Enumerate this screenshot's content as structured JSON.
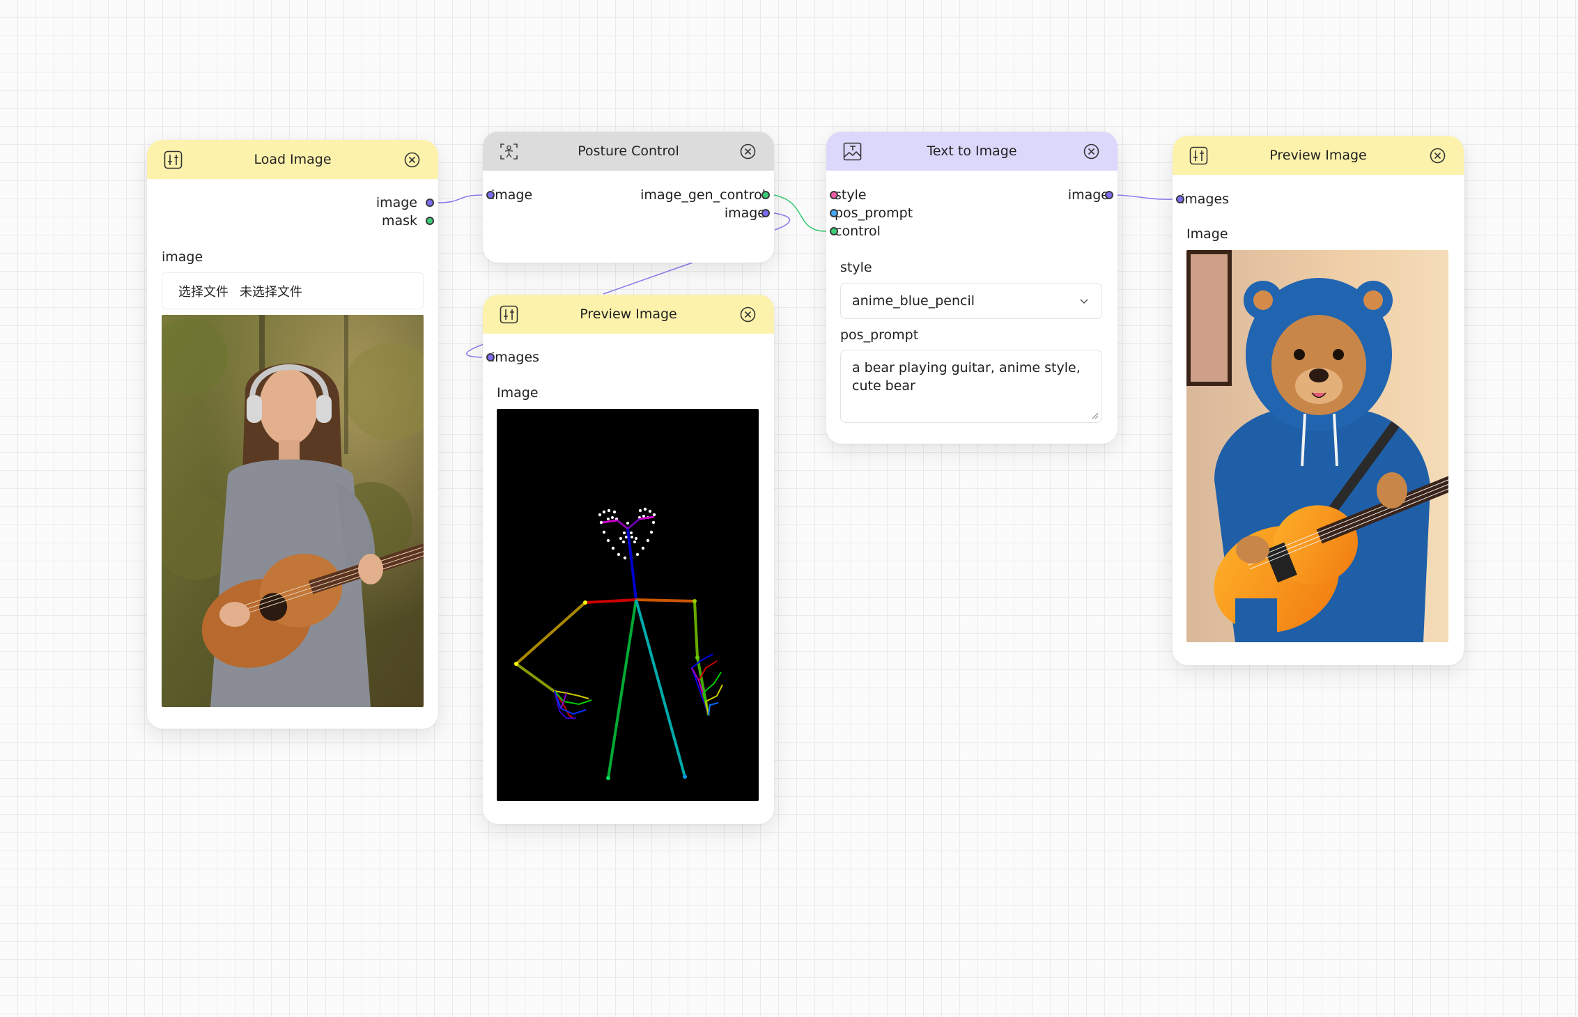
{
  "nodes": {
    "load_image": {
      "title": "Load Image",
      "outputs": [
        "image",
        "mask"
      ],
      "field_label": "image",
      "file_button": "选择文件",
      "file_status": "未选择文件"
    },
    "posture_control": {
      "title": "Posture Control",
      "inputs": [
        "image"
      ],
      "outputs": [
        "image_gen_control",
        "image"
      ]
    },
    "preview_image_pose": {
      "title": "Preview Image",
      "inputs": [
        "images"
      ],
      "field_label": "Image"
    },
    "text_to_image": {
      "title": "Text to Image",
      "inputs": [
        "style",
        "pos_prompt",
        "control"
      ],
      "outputs": [
        "image"
      ],
      "style_label": "style",
      "style_value": "anime_blue_pencil",
      "prompt_label": "pos_prompt",
      "prompt_value": "a bear playing guitar, anime style, cute bear"
    },
    "preview_image_result": {
      "title": "Preview Image",
      "inputs": [
        "images"
      ],
      "field_label": "Image"
    }
  },
  "colors": {
    "header_yellow": "#fcf2ac",
    "header_gray": "#dcdcdc",
    "header_purple": "#dcd8fc",
    "port_image": "#7b6cf2",
    "port_control": "#3dcc78",
    "port_style": "#f05aa8",
    "port_prompt": "#45a8f4",
    "wire_image": "#8a7ef0",
    "wire_control": "#3dcc78"
  },
  "icons": {
    "sliders": "sliders-icon",
    "posture": "person-scan-icon",
    "text_image": "image-text-icon",
    "close": "close-circle-icon",
    "dropdown": "chevron-down-icon"
  }
}
